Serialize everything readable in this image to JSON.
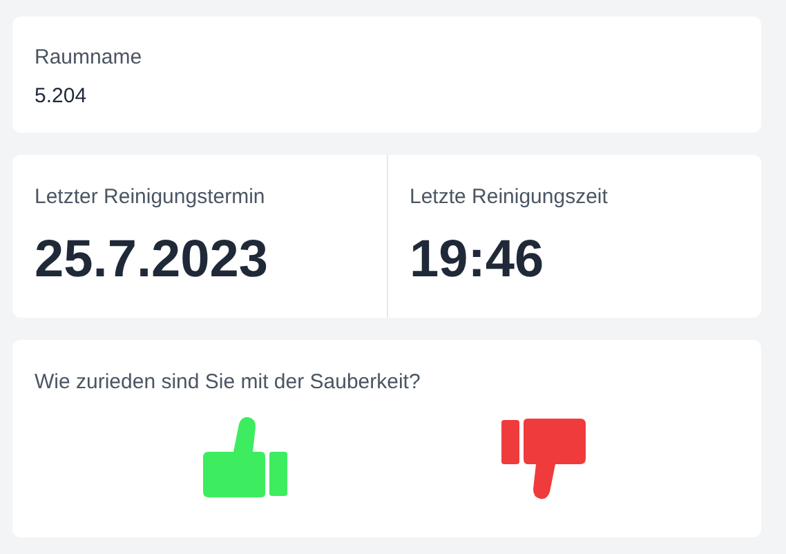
{
  "room": {
    "label": "Raumname",
    "value": "5.204"
  },
  "cleaning": [
    {
      "label": "Letzter Reinigungstermin",
      "value": "25.7.2023"
    },
    {
      "label": "Letzte Reinigungszeit",
      "value": "19:46"
    }
  ],
  "feedback": {
    "question": "Wie zurieden sind Sie mit der Sauberkeit?",
    "options": [
      {
        "kind": "up",
        "color": "#3ded5f"
      },
      {
        "kind": "down",
        "color": "#ef3b3b"
      }
    ]
  }
}
